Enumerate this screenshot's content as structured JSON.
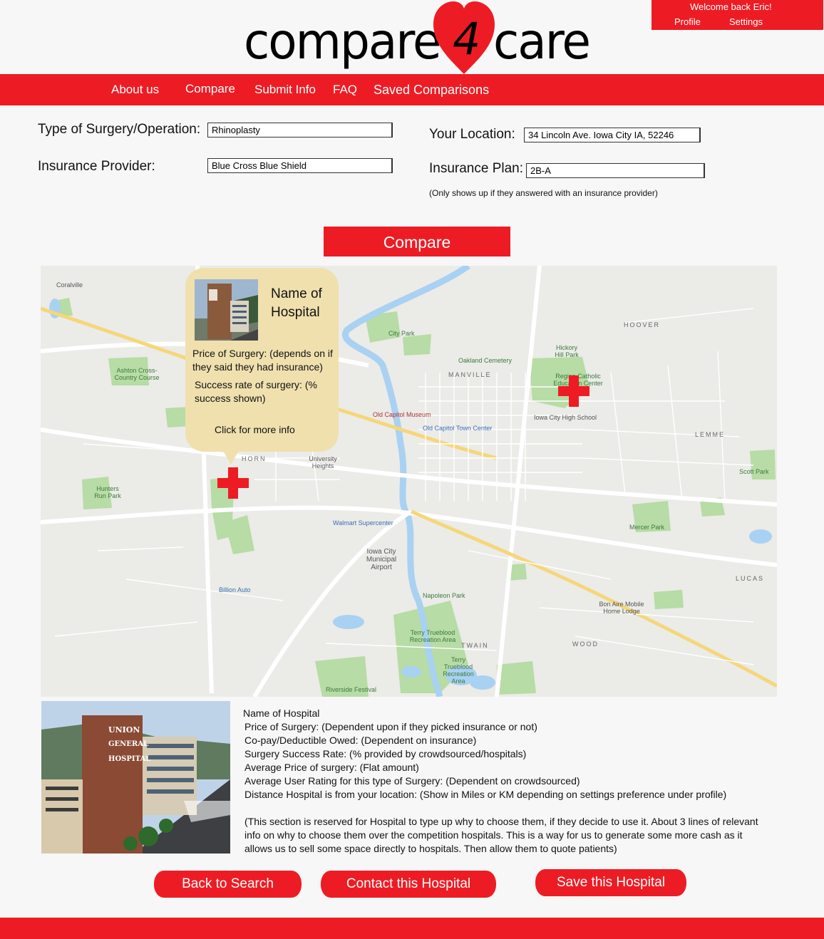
{
  "user_box": {
    "welcome": "Welcome back Eric!",
    "profile": "Profile",
    "settings": "Settings"
  },
  "logo": {
    "word_left": "compare",
    "heart_number": "4",
    "word_right": "care"
  },
  "nav": [
    {
      "label": "About us"
    },
    {
      "label": "Compare"
    },
    {
      "label": "Submit Info"
    },
    {
      "label": "FAQ"
    },
    {
      "label": "Saved Comparisons"
    }
  ],
  "form": {
    "surgery_label": "Type of Surgery/Operation:",
    "surgery_value": "Rhinoplasty",
    "insurance_label": "Insurance Provider:",
    "insurance_value": "Blue Cross Blue Shield",
    "location_label": "Your Location:",
    "location_value": "34 Lincoln Ave. Iowa City IA, 52246",
    "plan_label": "Insurance Plan:",
    "plan_value": "2B-A",
    "plan_note": "(Only shows up if they answered with an insurance provider)"
  },
  "compare_button": "Compare",
  "map": {
    "labels": {
      "coralville": "Coralville",
      "city_park": "City Park",
      "oakland": "Oakland Cemetery",
      "manville": "MANVILLE",
      "hoover": "HOOVER",
      "hickory": "Hickory Hill Park",
      "regina": "Regina Catholic Education Center",
      "iowa_city_high": "Iowa City High School",
      "old_capitol_museum": "Old Capitol Museum",
      "old_capitol_town": "Old Capitol Town Center",
      "lemme": "LEMME",
      "aspen": "Ashton Cross-Country Course",
      "university_heights": "University Heights",
      "hunters": "Hunters Run Park",
      "walmart": "Walmart Supercenter",
      "airport": "Iowa City Municipal Airport",
      "billion": "Billion Auto",
      "napoleon": "Napoleon Park",
      "terry": "Terry Trueblood Recreation Area",
      "terry2": "Terry Trueblood Recreation Area",
      "twain": "TWAIN",
      "wood": "WOOD",
      "lucas": "LUCAS",
      "mercer": "Mercer Park",
      "scott": "Scott Park",
      "bon_aire": "Bon Aire Mobile Home Lodge",
      "riverside": "Riverside Festival",
      "horn": "HORN"
    }
  },
  "callout": {
    "name": "Name of Hospital",
    "price": "Price of Surgery: (depends on if they said they had insurance)",
    "success": "Success rate of surgery: (% success shown)",
    "more": "Click for more info"
  },
  "photo_sign": [
    "UNION",
    "GENERAL",
    "HOSPITAL"
  ],
  "details": {
    "name": "Name of Hospital",
    "price": "Price of Surgery: (Dependent upon if they picked insurance or not)",
    "copay": "Co-pay/Deductible Owed: (Dependent on insurance)",
    "success": "Surgery Success Rate: (% provided by crowdsourced/hospitals)",
    "avg_price": "Average Price of surgery: (Flat amount)",
    "avg_rating": "Average User Rating for this type of Surgery: (Dependent on crowdsourced)",
    "distance": "Distance Hospital is from your location: (Show in Miles or KM depending on settings preference under profile)",
    "blurb": "(This section is reserved for Hospital to type up why to choose them, if they decide to use it. About 3 lines of relevant info on why to choose them over the competition hospitals. This is a way for us to generate some more cash as it allows us to sell some space directly to hospitals. Then allow them to quote patients)"
  },
  "buttons": {
    "back": "Back to Search",
    "contact": "Contact this Hospital",
    "save": "Save this Hospital"
  },
  "colors": {
    "brand_red": "#ed1c24",
    "callout": "#efe0ae",
    "map_bg": "#ebebe8",
    "park_green": "#b7dca5",
    "water_blue": "#a9d1f2"
  }
}
